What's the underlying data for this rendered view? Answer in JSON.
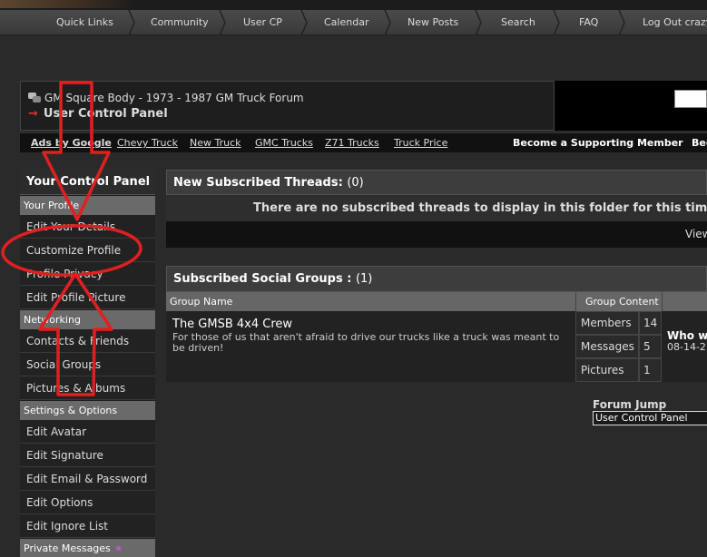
{
  "nav": {
    "items": [
      "Quick Links",
      "Community",
      "User CP",
      "Calendar",
      "New Posts",
      "Search",
      "FAQ",
      "Log Out crazy"
    ]
  },
  "header": {
    "forum_name": "GM Square Body - 1973 - 1987 GM Truck Forum",
    "page_title": "User Control Panel"
  },
  "ads": {
    "label": "Ads by Google",
    "links": [
      "Chevy Truck",
      "New Truck",
      "GMC Trucks",
      "Z71 Trucks",
      "Truck Price"
    ],
    "support": "Become a Supporting Member",
    "support_partial": "Bec"
  },
  "sidebar": {
    "title": "Your Control Panel",
    "sections": [
      {
        "label": "Your Profile",
        "items": [
          "Edit Your Details",
          "Customize Profile",
          "Profile Privacy",
          "Edit Profile Picture"
        ]
      },
      {
        "label": "Networking",
        "items": [
          "Contacts & Friends",
          "Social Groups",
          "Pictures & Albums"
        ]
      },
      {
        "label": "Settings & Options",
        "items": [
          "Edit Avatar",
          "Edit Signature",
          "Edit Email & Password",
          "Edit Options",
          "Edit Ignore List"
        ]
      },
      {
        "label": "Private Messages",
        "items": []
      }
    ]
  },
  "threads": {
    "title": "New Subscribed Threads:",
    "count": "(0)",
    "empty_message": "There are no subscribed threads to display in this folder for this time p",
    "view_link": "View"
  },
  "groups": {
    "title": "Subscribed Social Groups :",
    "count": "(1)",
    "col_group_name": "Group Name",
    "col_group_content": "Group Content",
    "group": {
      "name": "The GMSB 4x4 Crew",
      "description": "For those of us that aren't afraid to drive our trucks like a truck was meant to be driven!",
      "stats": [
        {
          "label": "Members",
          "value": "14"
        },
        {
          "label": "Messages",
          "value": "5"
        },
        {
          "label": "Pictures",
          "value": "1"
        }
      ],
      "last_title": "Who wa",
      "last_date": "08-14-2"
    }
  },
  "forum_jump": {
    "label": "Forum Jump",
    "selected": "User Control Panel"
  },
  "colors": {
    "annotation": "#e02020",
    "section_bg": "#6a6a6a",
    "panel_bg": "#3d3d3d"
  }
}
